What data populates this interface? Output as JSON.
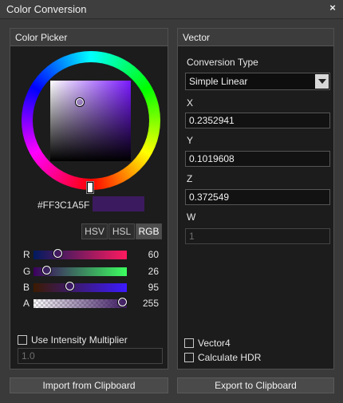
{
  "window": {
    "title": "Color Conversion",
    "close_glyph": "×"
  },
  "picker": {
    "header": "Color Picker",
    "hex": "#FF3C1A5F",
    "swatch_color": "#3C1A5F",
    "modes": [
      "HSV",
      "HSL",
      "RGB"
    ],
    "active_mode": "RGB",
    "channels": [
      {
        "label": "R",
        "value": "60",
        "fraction": 0.235
      },
      {
        "label": "G",
        "value": "26",
        "fraction": 0.102
      },
      {
        "label": "B",
        "value": "95",
        "fraction": 0.373
      },
      {
        "label": "A",
        "value": "255",
        "fraction": 1.0
      }
    ],
    "intensity_label": "Use Intensity Multiplier",
    "intensity_checked": false,
    "intensity_value": "1.0"
  },
  "vector": {
    "header": "Vector",
    "conversion_label": "Conversion Type",
    "conversion_value": "Simple Linear",
    "x_label": "X",
    "x_value": "0.2352941",
    "y_label": "Y",
    "y_value": "0.1019608",
    "z_label": "Z",
    "z_value": "0.372549",
    "w_label": "W",
    "w_value": "1",
    "vector4_label": "Vector4",
    "vector4_checked": false,
    "hdr_label": "Calculate HDR",
    "hdr_checked": false
  },
  "buttons": {
    "import": "Import from Clipboard",
    "export": "Export to Clipboard"
  }
}
